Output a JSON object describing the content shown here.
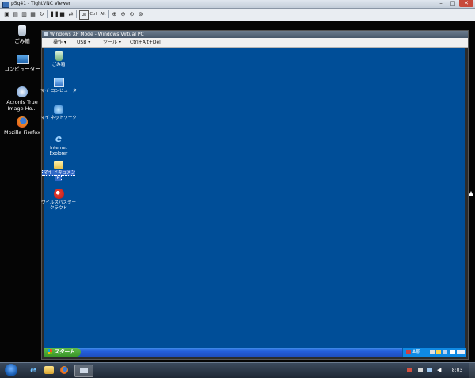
{
  "vnc": {
    "title": "p5g41 - TightVNC Viewer",
    "window_controls": {
      "minimize": "–",
      "maximize": "□",
      "close": "✕"
    },
    "toolbar_icons": [
      "new-connection-icon",
      "save-icon",
      "options-icon",
      "info-icon",
      "refresh-icon",
      "pause-icon",
      "stop-icon",
      "transfer-icon",
      "ctrl-alt-del-icon",
      "ctrl-key-icon",
      "alt-key-icon",
      "zoom-in-icon",
      "zoom-out-icon",
      "zoom-100-icon",
      "zoom-fit-icon"
    ],
    "toolbar_labels": {
      "ctrl": "Ctrl",
      "alt": "Alt"
    }
  },
  "win7_desktop": {
    "icons": [
      {
        "name": "recycle-bin-icon",
        "label": "ごみ箱"
      },
      {
        "name": "computer-icon",
        "label": "コンピューター"
      },
      {
        "name": "acronis-icon",
        "label": "Acronis True Image Ho..."
      },
      {
        "name": "firefox-icon",
        "label": "Mozilla Firefox"
      }
    ]
  },
  "xp_window": {
    "title": "Windows XP Mode - Windows Virtual PC",
    "menu": [
      {
        "label": "操作 ▾"
      },
      {
        "label": "USB ▾"
      },
      {
        "label": "ツール ▾"
      },
      {
        "label": "Ctrl+Alt+Del"
      }
    ],
    "desktop_icons": [
      {
        "name": "xp-recycle-bin-icon",
        "label": "ごみ箱"
      },
      {
        "name": "my-computer-icon",
        "label": "マイ コンピュータ"
      },
      {
        "name": "my-network-icon",
        "label": "マイ ネットワーク"
      },
      {
        "name": "ie-icon",
        "label": "Internet Explorer"
      },
      {
        "name": "my-documents-icon",
        "label": "マイ ドキュメント"
      },
      {
        "name": "virusbuster-icon",
        "label": "ウイルスバスター クラウド"
      }
    ],
    "start_label": "スタート",
    "tray_text": "A般"
  },
  "win7_taskbar": {
    "clock": "8:03"
  },
  "colors": {
    "xp_desktop": "#004e98",
    "xp_start": "#3a9628",
    "xp_taskbar": "#245edb"
  }
}
